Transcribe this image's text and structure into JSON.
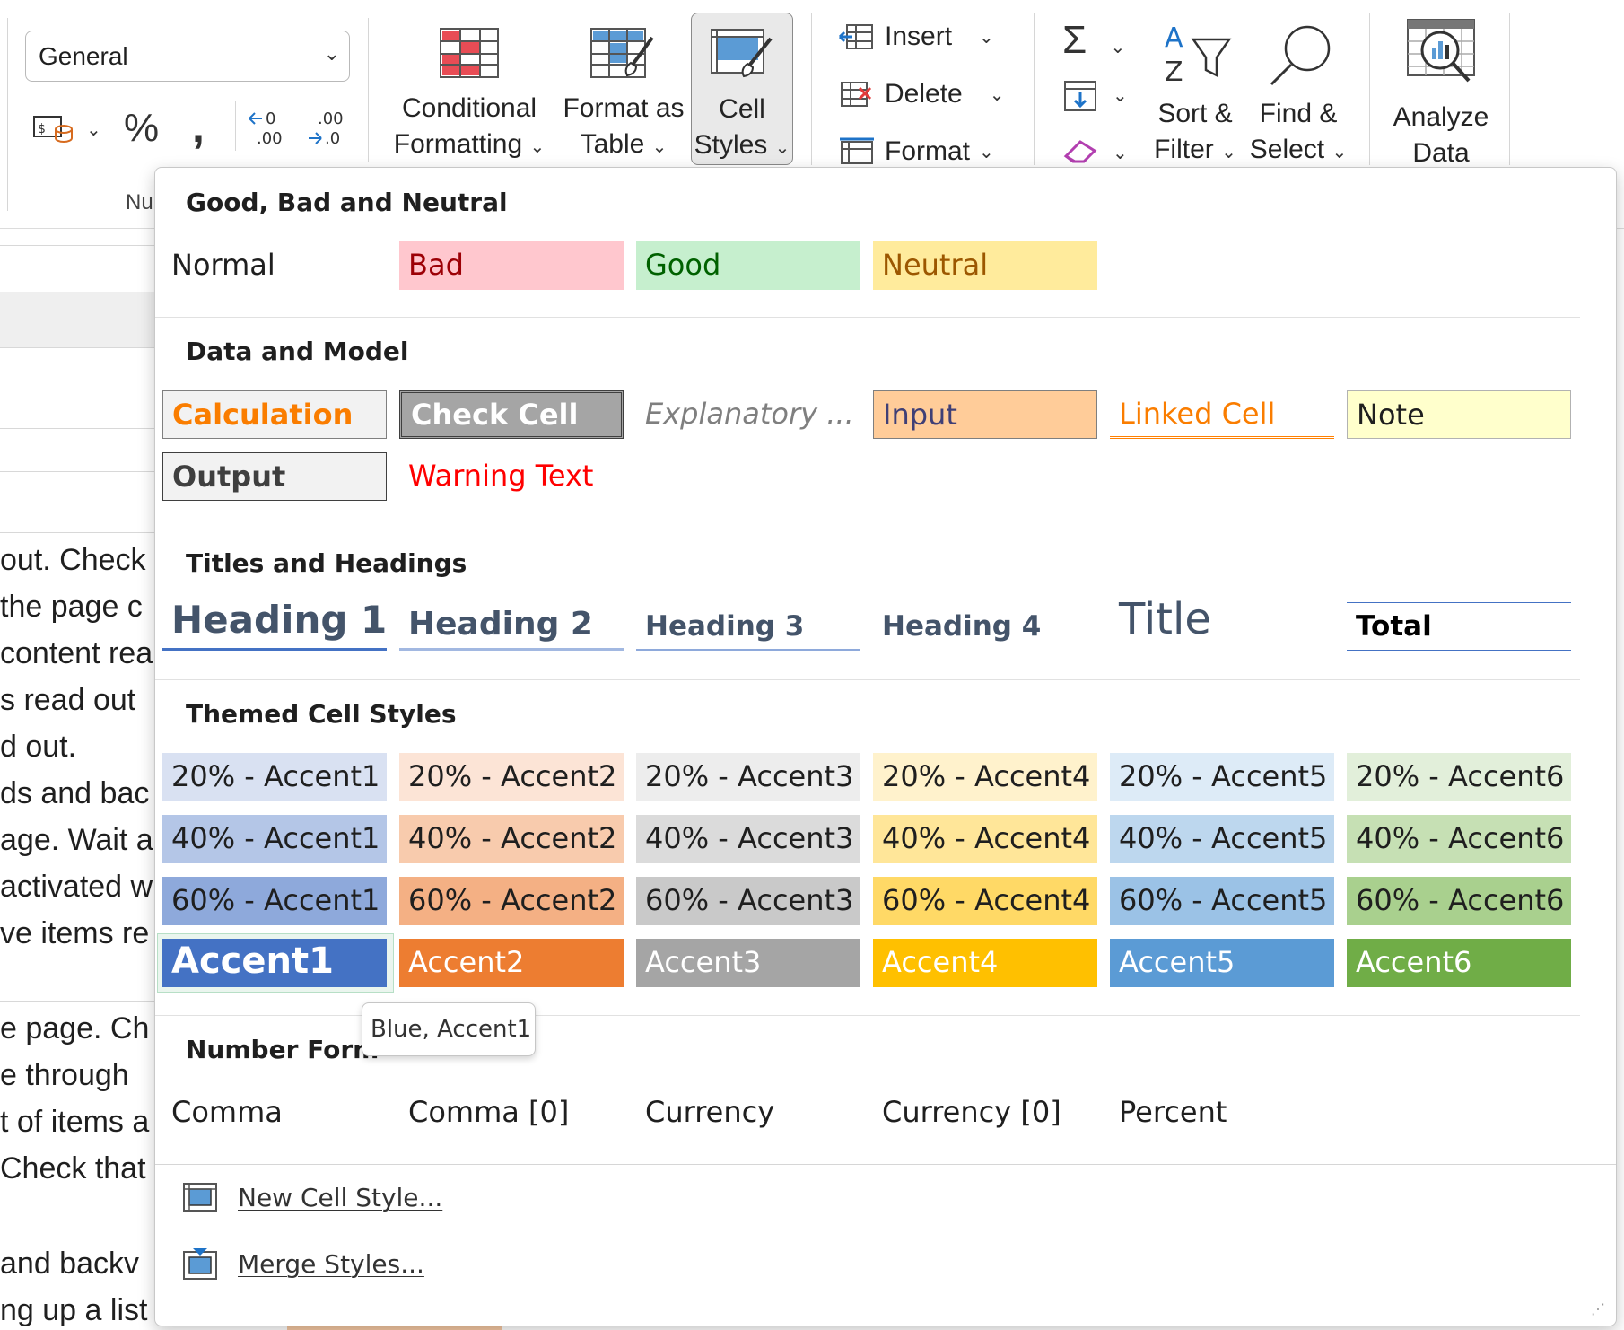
{
  "ribbon": {
    "number_format": "General",
    "number_group_label": "Nu",
    "conditional_formatting": [
      "Conditional",
      "Formatting"
    ],
    "format_as_table": [
      "Format as",
      "Table"
    ],
    "cell_styles": [
      "Cell",
      "Styles"
    ],
    "insert": "Insert",
    "delete": "Delete",
    "format": "Format",
    "sort_filter": [
      "Sort &",
      "Filter"
    ],
    "find_select": [
      "Find &",
      "Select"
    ],
    "analyze_data": [
      "Analyze",
      "Data"
    ],
    "chevron": "⌄"
  },
  "sheet_lines": [
    " out. Check",
    "the page c",
    "content rea",
    "s read out",
    "d out.",
    "ds and bac",
    "age. Wait a",
    "activated w",
    "ve items re",
    "e page. Ch",
    "e through",
    "t of items a",
    " Check that",
    " and backv",
    "ng up a list"
  ],
  "gallery": {
    "sections": {
      "good_bad": "Good, Bad and Neutral",
      "data_model": "Data and Model",
      "titles": "Titles and Headings",
      "themed": "Themed Cell Styles",
      "number_format": "Number Form"
    },
    "good_bad": [
      "Normal",
      "Bad",
      "Good",
      "Neutral"
    ],
    "data_model_row1": [
      "Calculation",
      "Check Cell",
      "Explanatory ...",
      "Input",
      "Linked Cell",
      "Note"
    ],
    "data_model_row2": [
      "Output",
      "Warning Text"
    ],
    "headings": [
      "Heading 1",
      "Heading 2",
      "Heading 3",
      "Heading 4",
      "Title",
      "Total"
    ],
    "themed": {
      "row20": [
        "20% - Accent1",
        "20% - Accent2",
        "20% - Accent3",
        "20% - Accent4",
        "20% - Accent5",
        "20% - Accent6"
      ],
      "row40": [
        "40% - Accent1",
        "40% - Accent2",
        "40% - Accent3",
        "40% - Accent4",
        "40% - Accent5",
        "40% - Accent6"
      ],
      "row60": [
        "60% - Accent1",
        "60% - Accent2",
        "60% - Accent3",
        "60% - Accent4",
        "60% - Accent5",
        "60% - Accent6"
      ],
      "rowAccent": [
        "Accent1",
        "Accent2",
        "Accent3",
        "Accent4",
        "Accent5",
        "Accent6"
      ]
    },
    "number_formats": [
      "Comma",
      "Comma [0]",
      "Currency",
      "Currency [0]",
      "Percent"
    ],
    "menu": [
      "New Cell Style...",
      "Merge Styles..."
    ],
    "tooltip": "Blue, Accent1"
  },
  "colors": {
    "bad_bg": "#ffc7ce",
    "bad_fg": "#9c0006",
    "good_bg": "#c6efce",
    "good_fg": "#006100",
    "neutral_bg": "#ffeb9c",
    "neutral_fg": "#9c5700",
    "accent1": "#4472c4",
    "accent2": "#ed7d31",
    "accent3": "#a5a5a5",
    "accent4": "#ffc000",
    "accent5": "#5b9bd5",
    "accent6": "#70ad47"
  }
}
